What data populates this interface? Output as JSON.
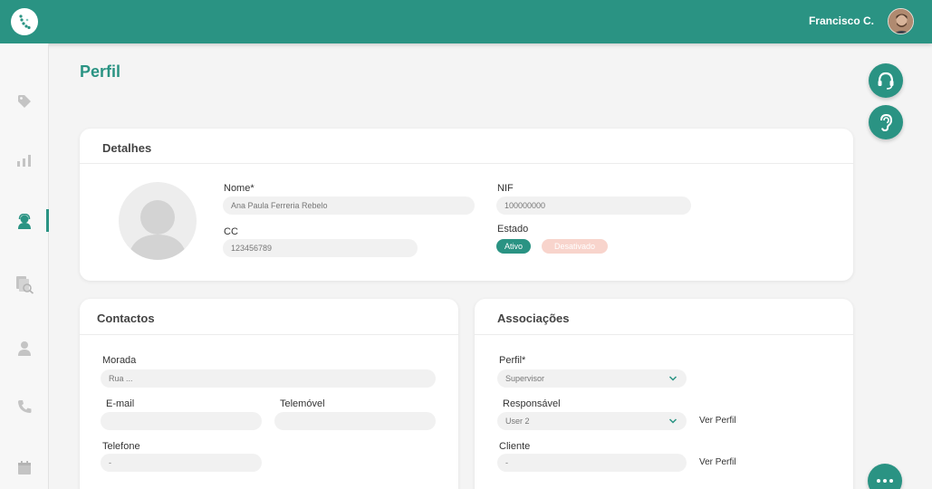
{
  "header": {
    "user_name": "Francisco C.",
    "brand_color": "#2a9383"
  },
  "sidebar": {
    "items": [
      {
        "icon": "tag-icon",
        "active": false
      },
      {
        "icon": "bar-chart-icon",
        "active": false
      },
      {
        "icon": "agent-icon",
        "active": true
      },
      {
        "icon": "document-search-icon",
        "active": false
      },
      {
        "icon": "user-icon",
        "active": false
      },
      {
        "icon": "phone-icon",
        "active": false
      },
      {
        "icon": "calendar-icon",
        "active": false
      }
    ]
  },
  "page": {
    "title": "Perfil"
  },
  "detalhes": {
    "title": "Detalhes",
    "nome_label": "Nome*",
    "nome_value": "Ana Paula Ferreria Rebelo",
    "cc_label": "CC",
    "cc_value": "123456789",
    "nif_label": "NIF",
    "nif_value": "100000000",
    "estado_label": "Estado",
    "estado_active": "Ativo",
    "estado_inactive": "Desativado"
  },
  "contactos": {
    "title": "Contactos",
    "morada_label": "Morada",
    "morada_placeholder": "Rua ...",
    "email_label": "E-mail",
    "email_value": "",
    "telemovel_label": "Telemóvel",
    "telemovel_value": "",
    "telefone_label": "Telefone",
    "telefone_value": "-"
  },
  "associacoes": {
    "title": "Associações",
    "perfil_label": "Perfil*",
    "perfil_value": "Supervisor",
    "responsavel_label": "Responsável",
    "responsavel_value": "User 2",
    "ver_perfil_1": "Ver Perfil",
    "cliente_label": "Cliente",
    "cliente_value": "-",
    "ver_perfil_2": "Ver Perfil"
  }
}
